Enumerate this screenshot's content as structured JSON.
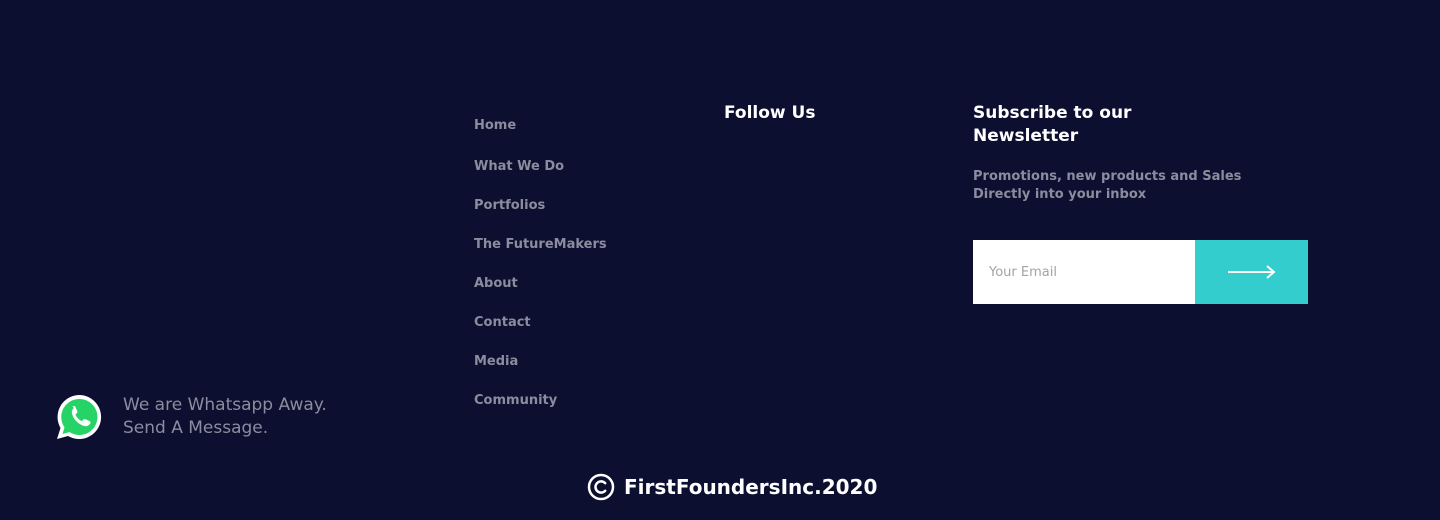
{
  "nav": {
    "items": [
      {
        "label": "Home"
      },
      {
        "label": "What We Do"
      },
      {
        "label": "Portfolios"
      },
      {
        "label": "The FutureMakers"
      },
      {
        "label": "About"
      },
      {
        "label": "Contact"
      },
      {
        "label": "Media"
      },
      {
        "label": "Community"
      }
    ]
  },
  "follow": {
    "title": "Follow Us"
  },
  "newsletter": {
    "title": "Subscribe to our Newsletter",
    "description_line1": "Promotions, new products and Sales",
    "description_line2": "Directly into your inbox",
    "email_placeholder": "Your Email",
    "email_value": "",
    "submit_icon": "arrow-right-icon"
  },
  "whatsapp": {
    "icon": "whatsapp-icon",
    "line1": "We are Whatsapp Away.",
    "line2": "Send A Message."
  },
  "footer": {
    "copyright_icon": "copyright-icon",
    "copyright_text": "FirstFoundersInc.2020"
  },
  "colors": {
    "background": "#0d0f30",
    "accent": "#34cdcd",
    "muted_text": "#8b8d9e",
    "heading_text": "#ffffff",
    "whatsapp_green": "#25d366"
  }
}
